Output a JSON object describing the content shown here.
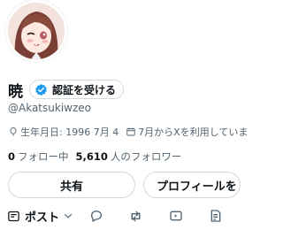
{
  "profile": {
    "display_name": "暁",
    "verify_label": "認証を受ける",
    "handle": "@Akatsukiwzeo",
    "birthday": "生年月日: 1996 7月 4",
    "joined": "7月からXを利用していま"
  },
  "stats": {
    "following_count": "0",
    "following_label": "フォロー中",
    "followers_count": "5,610",
    "followers_label": "人のフォロワー"
  },
  "actions": {
    "share_label": "共有",
    "edit_profile_label": "プロフィールを"
  },
  "post_bar": {
    "post_label": "ポスト",
    "icons": [
      "compose-post-icon",
      "chevron-down-icon",
      "reply-icon",
      "repost-icon",
      "media-icon",
      "article-icon"
    ]
  },
  "colors": {
    "verified_blue": "#1d9bf0",
    "text_primary": "#0f1419",
    "text_secondary": "#536471",
    "border": "#cfd9de"
  }
}
